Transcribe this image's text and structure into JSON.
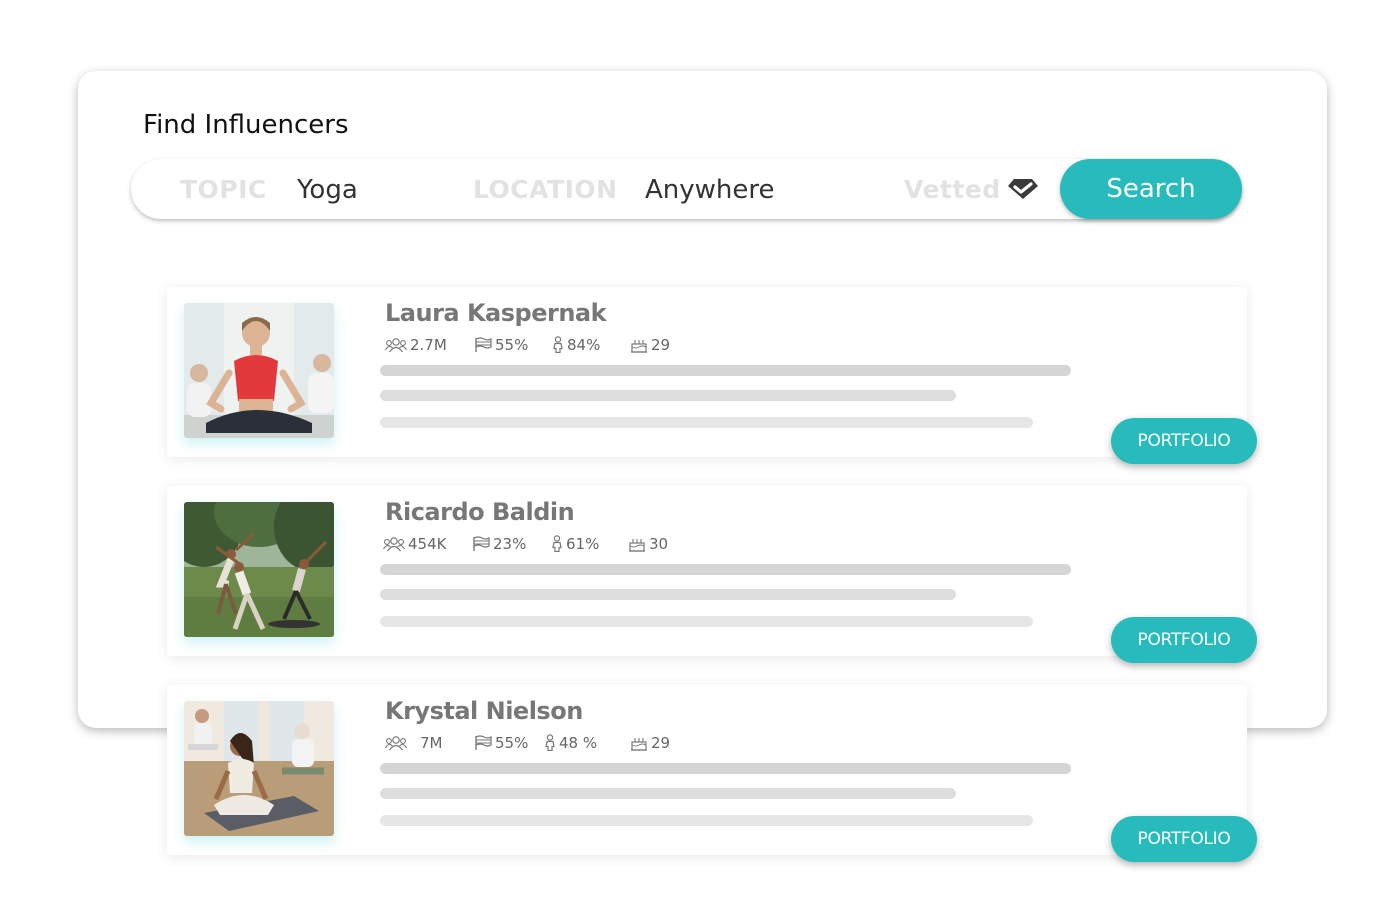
{
  "page": {
    "title": "Find Influencers"
  },
  "search": {
    "topic_label": "TOPIC",
    "topic_value": "Yoga",
    "location_label": "LOCATION",
    "location_value": "Anywhere",
    "vetted_label": "Vetted",
    "vetted_icon": "diamond-icon",
    "button_label": "Search"
  },
  "colors": {
    "accent": "#27bcbb",
    "muted_label": "#e2e2e2",
    "name_text": "#777777",
    "placeholder_line": "#d5d5d5"
  },
  "influencers": [
    {
      "name": "Laura Kaspernak",
      "followers": "2.7M",
      "country_pct": "55%",
      "gender_pct": "84%",
      "age": "29",
      "portfolio_label": "PORTFOLIO"
    },
    {
      "name": "Ricardo Baldin",
      "followers": "454K",
      "country_pct": "23%",
      "gender_pct": "61%",
      "age": "30",
      "portfolio_label": "PORTFOLIO"
    },
    {
      "name": "Krystal Nielson",
      "followers": "7M",
      "country_pct": "55%",
      "gender_pct": "48 %",
      "age": "29",
      "portfolio_label": "PORTFOLIO"
    }
  ],
  "icons": {
    "followers": "followers-icon",
    "country": "flag-icon",
    "gender": "person-icon",
    "age": "birthday-cake-icon"
  }
}
